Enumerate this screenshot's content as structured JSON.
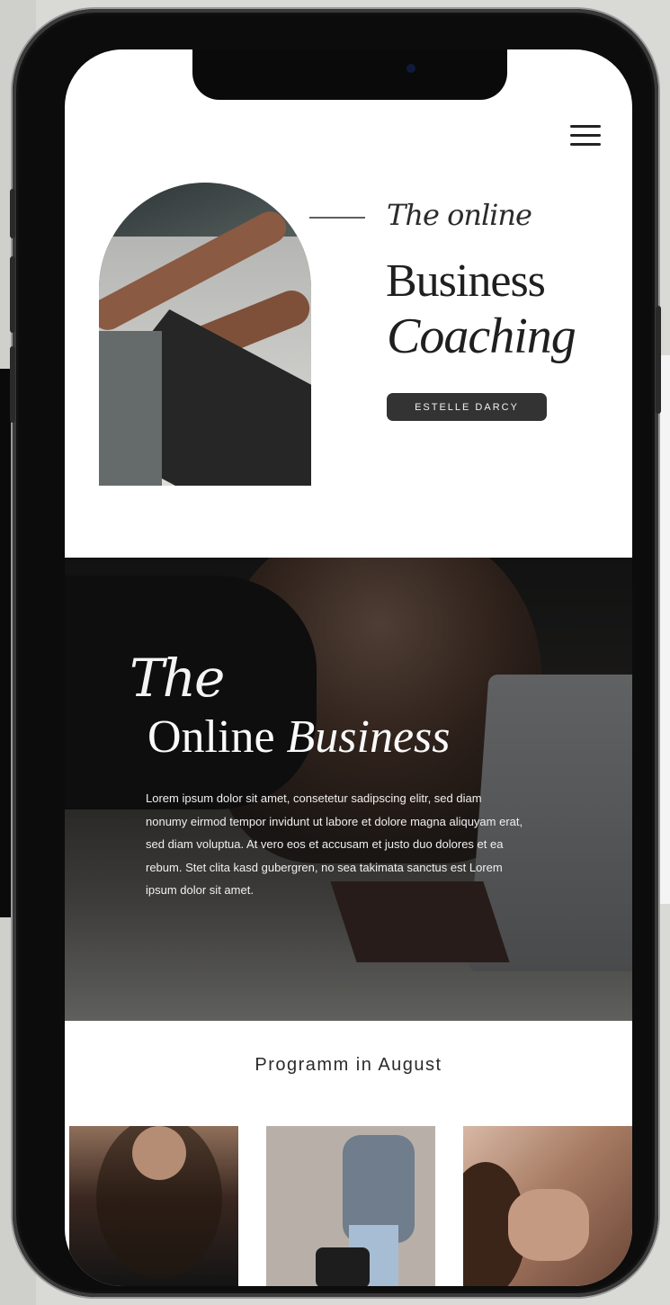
{
  "nav": {
    "menu_icon": "hamburger-menu-icon"
  },
  "hero": {
    "script_text": "The online",
    "title_line1": "Business",
    "title_line2": "Coaching",
    "author_button": "ESTELLE DARCY"
  },
  "feature": {
    "script_text": "The",
    "title_plain": "Online",
    "title_italic": "Business",
    "body": "Lorem ipsum dolor sit amet, consetetur sadipscing elitr, sed diam nonumy eirmod tempor invidunt ut labore et dolore magna aliquyam erat, sed diam voluptua. At vero eos et accusam et justo duo dolores et ea rebum. Stet clita kasd gubergren, no sea takimata sanctus est Lorem ipsum dolor sit amet."
  },
  "program": {
    "heading": "Programm in August"
  },
  "colors": {
    "button_bg": "#333333",
    "text_dark": "#1f1f1f",
    "page_bg": "#ffffff"
  }
}
